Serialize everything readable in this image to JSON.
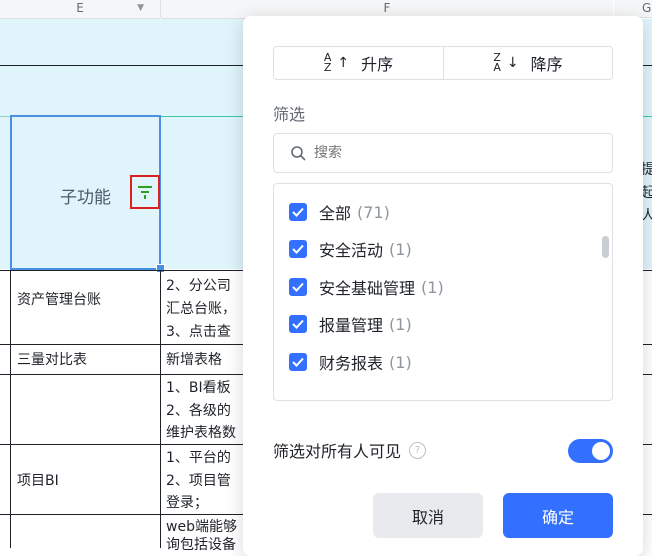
{
  "sheet": {
    "columns": {
      "e": "E",
      "f": "F",
      "g": "G"
    },
    "header_cell": "子功能",
    "rows": [
      {
        "col_e": "资产管理台账",
        "col_f": [
          "2、分公司",
          "汇总台账，",
          "3、点击查"
        ]
      },
      {
        "col_e": "三量对比表",
        "col_f": [
          "新增表格"
        ]
      },
      {
        "col_e": "",
        "col_f": [
          "1、BI看板",
          "2、各级的",
          "维护表格数"
        ]
      },
      {
        "col_e": "项目BI",
        "col_f": [
          "1、平台的",
          "2、项目管",
          "登录；"
        ]
      },
      {
        "col_e": "",
        "col_f": [
          "web端能够",
          "询包括设备"
        ]
      }
    ],
    "g_fragments": [
      "提",
      "起",
      "人"
    ]
  },
  "filter_panel": {
    "sort_asc": "升序",
    "sort_desc": "降序",
    "filter_title": "筛选",
    "search_placeholder": "搜索",
    "items": [
      {
        "label": "全部",
        "count": "(71)"
      },
      {
        "label": "安全活动",
        "count": "(1)"
      },
      {
        "label": "安全基础管理",
        "count": "(1)"
      },
      {
        "label": "报量管理",
        "count": "(1)"
      },
      {
        "label": "财务报表",
        "count": "(1)"
      }
    ],
    "visible_to_all_label": "筛选对所有人可见",
    "visible_to_all_on": true,
    "cancel": "取消",
    "confirm": "确定"
  },
  "colors": {
    "accent": "#3370ff",
    "header_bg": "#e0f4fc",
    "selection": "#4a90e2",
    "filter_icon": "#2ea121"
  }
}
